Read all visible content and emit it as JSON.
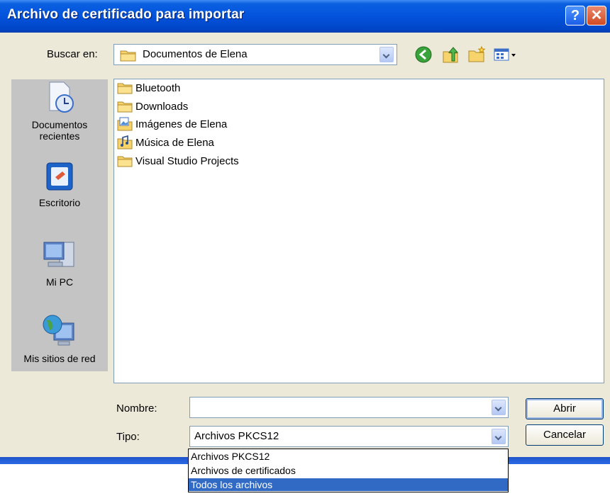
{
  "window": {
    "title": "Archivo de certificado para importar",
    "help": "?",
    "close": "✕"
  },
  "lookin": {
    "label": "Buscar en:",
    "value": "Documentos de Elena"
  },
  "toolbar": {
    "icons": [
      "back-icon",
      "up-folder-icon",
      "new-folder-icon",
      "view-menu-icon"
    ]
  },
  "places": [
    {
      "label": "Documentos\nrecientes",
      "icon": "recent-documents-icon"
    },
    {
      "label": "Escritorio",
      "icon": "desktop-icon"
    },
    {
      "label": "Mi PC",
      "icon": "my-computer-icon"
    },
    {
      "label": "Mis sitios de red",
      "icon": "network-places-icon"
    }
  ],
  "files": [
    {
      "name": "Bluetooth",
      "icon": "folder-icon"
    },
    {
      "name": "Downloads",
      "icon": "folder-icon"
    },
    {
      "name": "Imágenes de Elena",
      "icon": "pictures-folder-icon"
    },
    {
      "name": "Música de Elena",
      "icon": "music-folder-icon"
    },
    {
      "name": "Visual Studio Projects",
      "icon": "folder-icon"
    }
  ],
  "filename": {
    "label": "Nombre:",
    "value": ""
  },
  "filetype": {
    "label": "Tipo:",
    "value": "Archivos PKCS12",
    "options": [
      "Archivos PKCS12",
      "Archivos de certificados",
      "Todos los archivos"
    ],
    "highlighted": "Todos los archivos"
  },
  "buttons": {
    "open": "Abrir",
    "cancel": "Cancelar"
  },
  "colors": {
    "titlebar": "#0453dc",
    "dialog": "#ece9d8",
    "selection": "#316ac5",
    "places_bar": "#c4c4c4"
  }
}
